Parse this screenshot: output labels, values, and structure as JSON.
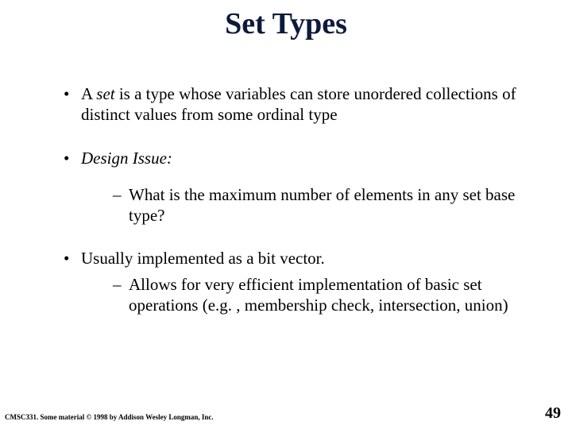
{
  "title": "Set Types",
  "bullets": {
    "b1a_pre": "A ",
    "b1a_em": "set",
    "b1a_post": " is a type whose variables can store unordered collections of distinct values from some ordinal type",
    "b1b_em": "Design Issue:",
    "b2a": "What is the maximum number of elements in any set base type?",
    "b1c": "Usually implemented as a bit vector.",
    "b2b": "Allows for very efficient implementation of basic set operations (e.g. , membership check, intersection, union)"
  },
  "footer": {
    "left": "CMSC331. Some material © 1998 by Addison Wesley Longman, Inc.",
    "page": "49"
  }
}
